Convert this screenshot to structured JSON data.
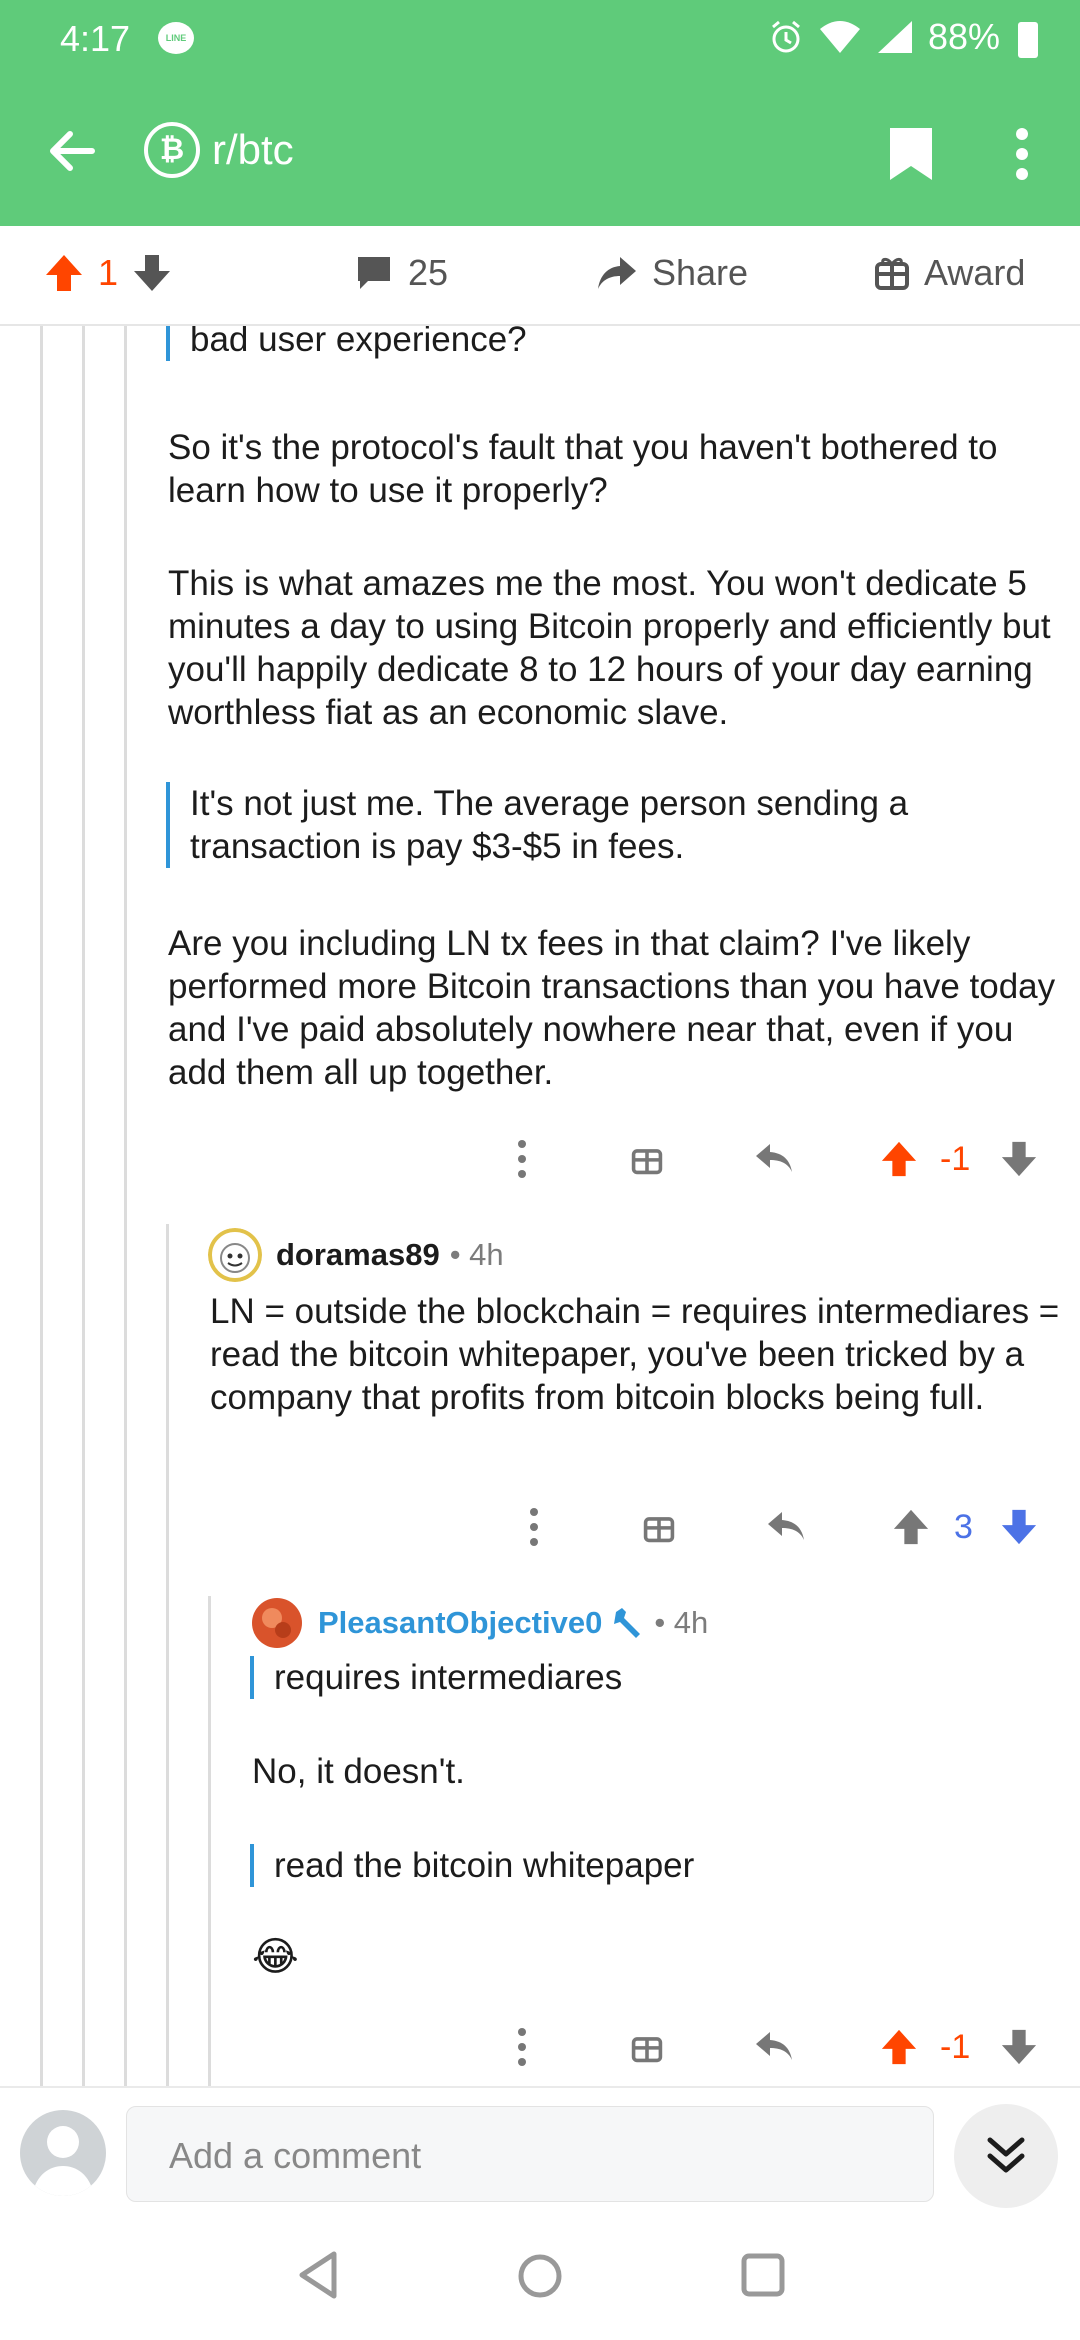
{
  "status_bar": {
    "time": "4:17",
    "line_badge": "LINE",
    "battery": "88%"
  },
  "app_bar": {
    "subreddit": "r/btc"
  },
  "post_actions": {
    "score": "1",
    "comments": "25",
    "share": "Share",
    "award": "Award"
  },
  "comments": [
    {
      "quote_tail": "bad user experience?",
      "paragraphs": [
        "So it's the protocol's fault that you haven't bothered to learn how to use it properly?",
        "This is what amazes me the most.  You won't dedicate 5 minutes a day to using Bitcoin properly and efficiently but you'll happily dedicate 8 to 12 hours of your day earning worthless fiat as an economic slave."
      ],
      "quote": "It's not just me. The average person sending a transaction is pay $3-$5 in fees.",
      "closing": "Are you including LN tx fees in that claim?  I've likely performed more Bitcoin transactions than you have today and I've paid absolutely nowhere near that, even if you add them all up together.",
      "score": "-1"
    },
    {
      "user": "doramas89",
      "age": "• 4h",
      "body": "LN = outside the blockchain = requires intermediares = read the bitcoin whitepaper, you've been tricked by a company that profits from bitcoin blocks being full.",
      "score": "3"
    },
    {
      "user": "PleasantObjective0",
      "age": "• 4h",
      "quote1": "requires intermediares",
      "reply": "No, it doesn't.",
      "quote2": "read the bitcoin whitepaper",
      "emoji": "😂",
      "score": "-1"
    }
  ],
  "compose": {
    "placeholder": "Add a comment"
  },
  "colors": {
    "header_green": "#5fcb7a",
    "upvote_orange": "#ff4500",
    "downvote_blue": "#4c72e6",
    "quote_bar": "#2f95d8"
  }
}
